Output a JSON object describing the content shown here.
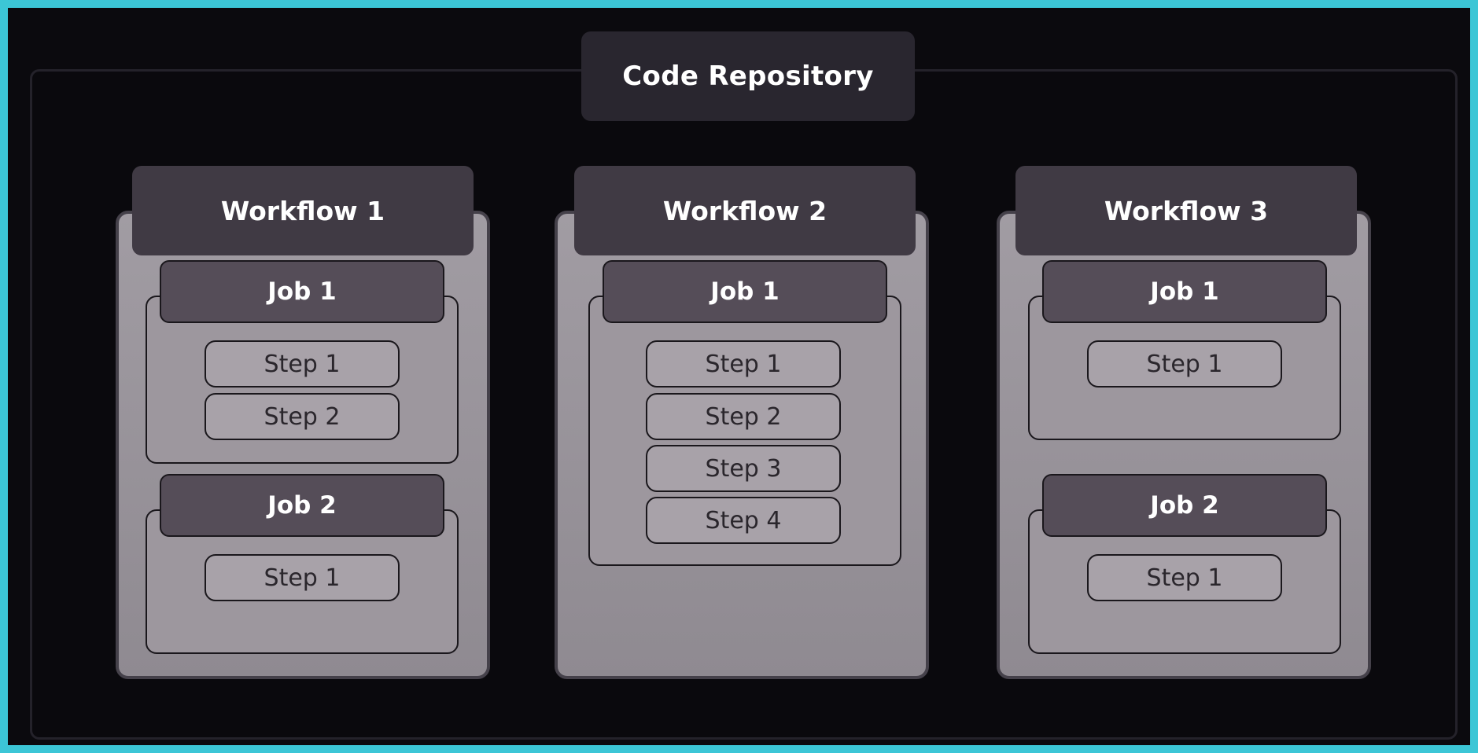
{
  "repository": {
    "title": "Code Repository"
  },
  "workflows": [
    {
      "title": "Workflow 1",
      "jobs": [
        {
          "title": "Job 1",
          "steps": [
            "Step 1",
            "Step 2"
          ]
        },
        {
          "title": "Job 2",
          "steps": [
            "Step 1"
          ]
        }
      ]
    },
    {
      "title": "Workflow 2",
      "jobs": [
        {
          "title": "Job 1",
          "steps": [
            "Step 1",
            "Step 2",
            "Step 3",
            "Step 4"
          ]
        }
      ]
    },
    {
      "title": "Workflow 3",
      "jobs": [
        {
          "title": "Job 1",
          "steps": [
            "Step 1"
          ]
        },
        {
          "title": "Job 2",
          "steps": [
            "Step 1"
          ]
        }
      ]
    }
  ],
  "colors": {
    "frame_border": "#3cc6d6",
    "background": "#0b0a0e",
    "workflow_header": "#403a44",
    "job_header": "#554d58",
    "panel": "#9d979e"
  }
}
